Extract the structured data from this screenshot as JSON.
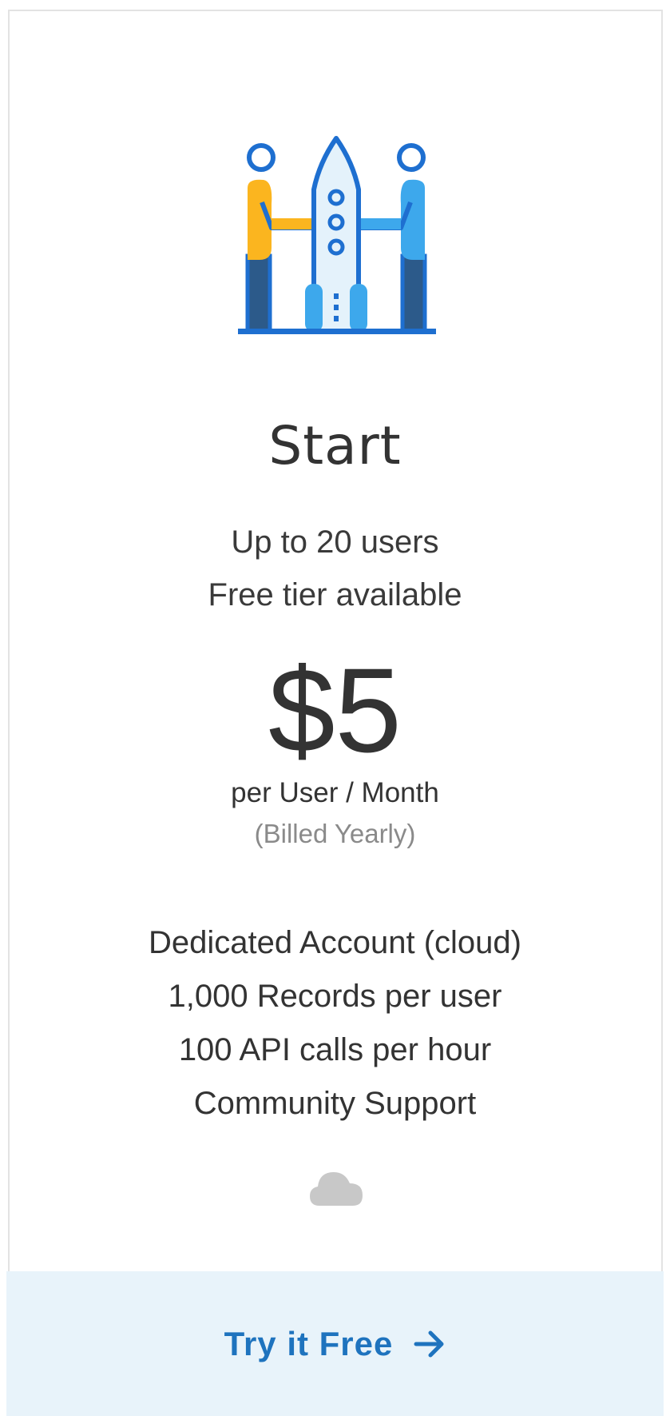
{
  "plan": {
    "title": "Start",
    "users": "Up to 20 users",
    "tier_note": "Free tier available",
    "price": "$5",
    "price_unit": "per User / Month",
    "billing_note": "(Billed Yearly)"
  },
  "features": [
    "Dedicated Account (cloud)",
    "1,000 Records per user",
    "100 API calls per hour",
    "Community Support"
  ],
  "icons": {
    "illustration": "rocket-team-illustration",
    "deployment": "cloud-icon",
    "cta_arrow": "arrow-right-icon"
  },
  "cta": {
    "label": "Try it Free"
  },
  "colors": {
    "accent": "#1e73be",
    "cta_background": "#e8f3fa",
    "yellow_figure": "#fbb51f",
    "blue_figure": "#3da8ec",
    "dark_leg": "#2c5a8a",
    "muted_text": "#8a8a8a"
  }
}
